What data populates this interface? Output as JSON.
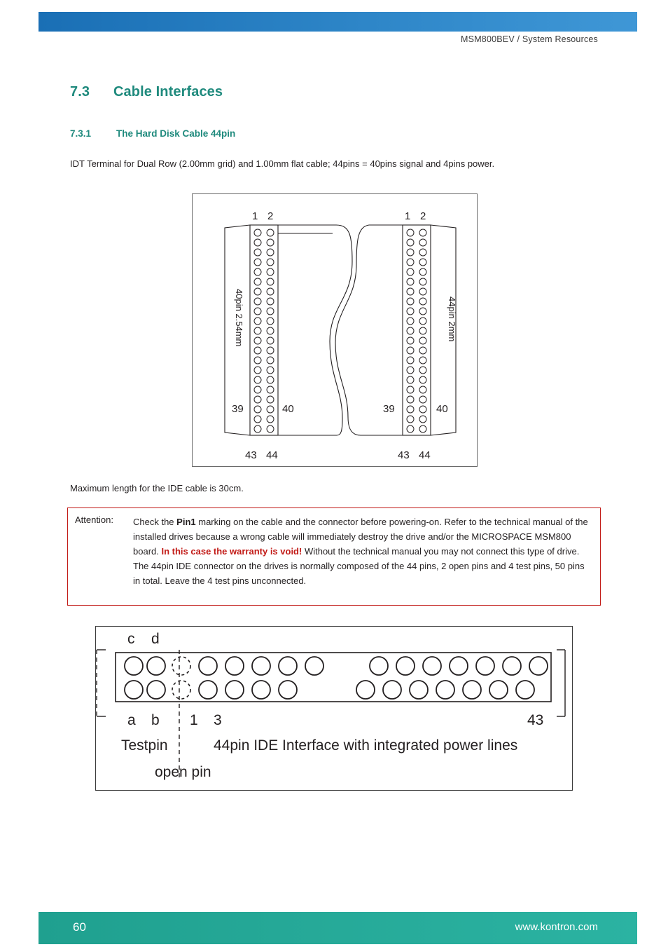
{
  "header": {
    "title": "MSM800BEV / System Resources"
  },
  "section": {
    "number": "7.3",
    "title": "Cable Interfaces"
  },
  "subsection": {
    "number": "7.3.1",
    "title": "The Hard Disk Cable 44pin"
  },
  "intro": "IDT Terminal for Dual Row (2.00mm grid) and 1.00mm flat cable; 44pins = 40pins signal and 4pins power.",
  "max_length": "Maximum length for the IDE cable is 30cm.",
  "figure1": {
    "left_connector": {
      "top_labels": [
        "1",
        "2"
      ],
      "side_label": "40pin 2.54mm",
      "mid_labels": [
        "39",
        "40"
      ],
      "bottom_labels": [
        "43",
        "44"
      ]
    },
    "right_connector": {
      "top_labels": [
        "1",
        "2"
      ],
      "side_label": "44pin 2mm",
      "mid_labels": [
        "39",
        "40"
      ],
      "bottom_labels": [
        "43",
        "44"
      ]
    }
  },
  "attention": {
    "label": "Attention:",
    "p1_before": "Check the ",
    "p1_bold": "Pin1",
    "p1_after": " marking on the cable and the connector before powering-on. Refer to the technical manual of the installed drives because a wrong cable will immediately destroy the drive and/or the MICROSPACE MSM800 board. ",
    "p1_red": "In this case the warranty is void!",
    "p1_tail": " Without the technical manual you may not connect this type of drive.",
    "p2": "The 44pin IDE connector on the drives is normally composed of the 44 pins, 2 open pins and 4 test pins, 50 pins in total. Leave the 4 test pins unconnected."
  },
  "figure2": {
    "label_c": "c",
    "label_d": "d",
    "label_a": "a",
    "label_b": "b",
    "label_1": "1",
    "label_3": "3",
    "label_43": "43",
    "testpin": "Testpin",
    "caption": "44pin  IDE  Interface with integrated power lines",
    "open_pin": "open pin"
  },
  "footer": {
    "page": "60",
    "url": "www.kontron.com"
  }
}
